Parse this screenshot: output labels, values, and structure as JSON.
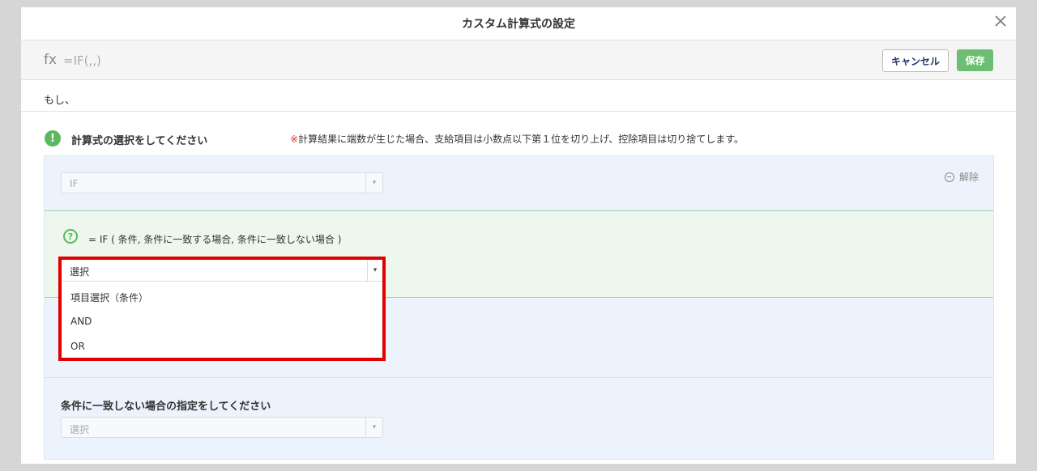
{
  "modal": {
    "title": "カスタム計算式の設定"
  },
  "formula": {
    "fx": "fx",
    "text": "=IF(,,)"
  },
  "buttons": {
    "cancel": "キャンセル",
    "save": "保存"
  },
  "if_description": "もし、",
  "section": {
    "title": "計算式の選択をしてください",
    "note_mark": "※",
    "note": "計算結果に端数が生じた場合、支給項目は小数点以下第１位を切り上げ、控除項目は切り捨てします。"
  },
  "function_select": {
    "value": "IF"
  },
  "remove_link": "解除",
  "syntax": "= IF ( 条件, 条件に一致する場合, 条件に一致しない場合 )",
  "condition_dropdown": {
    "value": "選択",
    "options": [
      "項目選択（条件）",
      "AND",
      "OR"
    ]
  },
  "else_section": {
    "title": "条件に一致しない場合の指定をしてください",
    "select_value": "選択"
  },
  "colors": {
    "save_green": "#6cbf72",
    "highlight_red": "#e00000",
    "panel_blue": "#edf3fc",
    "green_box": "#edf7ee"
  }
}
